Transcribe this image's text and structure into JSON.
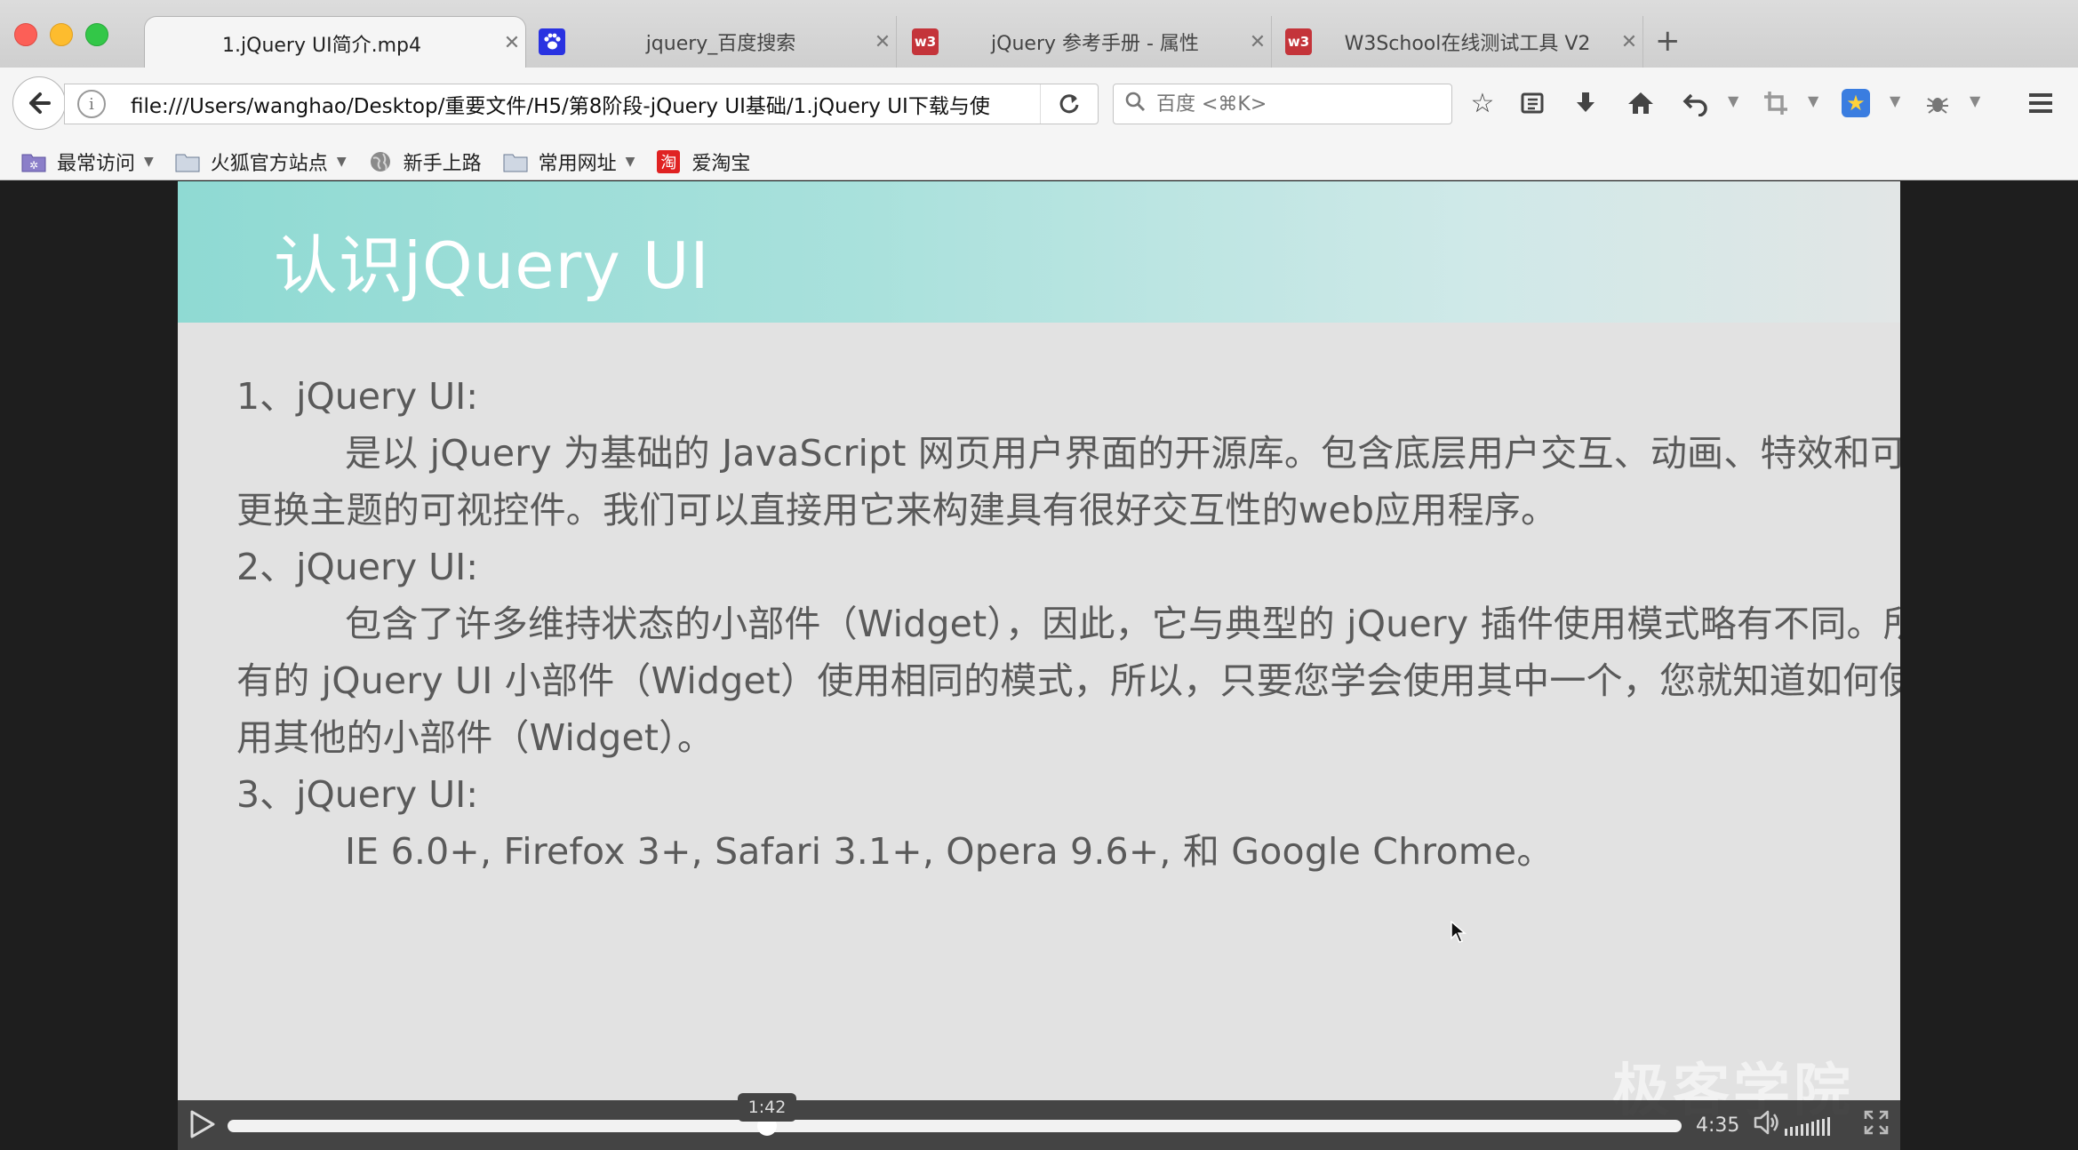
{
  "tabs": [
    {
      "label": "1.jQuery UI简介.mp4",
      "active": true
    },
    {
      "label": "jquery_百度搜索",
      "active": false
    },
    {
      "label": "jQuery 参考手册 - 属性",
      "active": false
    },
    {
      "label": "W3School在线测试工具 V2",
      "active": false
    }
  ],
  "tab_favicons": {
    "w3": "w3"
  },
  "new_tab": "+",
  "address": {
    "url": "file:///Users/wanghao/Desktop/重要文件/H5/第8阶段-jQuery UI基础/1.jQuery UI下载与使"
  },
  "search": {
    "placeholder": "百度 <⌘K>"
  },
  "bookmarks": [
    {
      "label": "最常访问"
    },
    {
      "label": "火狐官方站点"
    },
    {
      "label": "新手上路"
    },
    {
      "label": "常用网址"
    },
    {
      "label": "爱淘宝"
    }
  ],
  "bookmark_taobao_icon": "淘",
  "slide": {
    "title": "认识jQuery UI",
    "points": [
      {
        "heading": "1、jQuery UI:",
        "text": "是以 jQuery 为基础的 JavaScript 网页用户界面的开源库。包含底层用户交互、动画、特效和可更换主题的可视控件。我们可以直接用它来构建具有很好交互性的web应用程序。"
      },
      {
        "heading": "2、jQuery UI:",
        "text": "包含了许多维持状态的小部件（Widget），因此，它与典型的 jQuery 插件使用模式略有不同。所有的 jQuery UI 小部件（Widget）使用相同的模式，所以，只要您学会使用其中一个，您就知道如何使用其他的小部件（Widget）。"
      },
      {
        "heading": "3、jQuery UI:",
        "text": "IE 6.0+, Firefox 3+, Safari 3.1+, Opera 9.6+, 和 Google Chrome。"
      }
    ],
    "watermark": "极客学院"
  },
  "player": {
    "current_time": "1:42",
    "duration": "4:35",
    "progress": 0.371
  },
  "colors": {
    "slide_header": "#8fdad3",
    "slide_bg": "#e2e2e2",
    "tab_bg": "#f5f5f5",
    "w3_red": "#c4343a",
    "baidu_blue": "#2932e1"
  }
}
